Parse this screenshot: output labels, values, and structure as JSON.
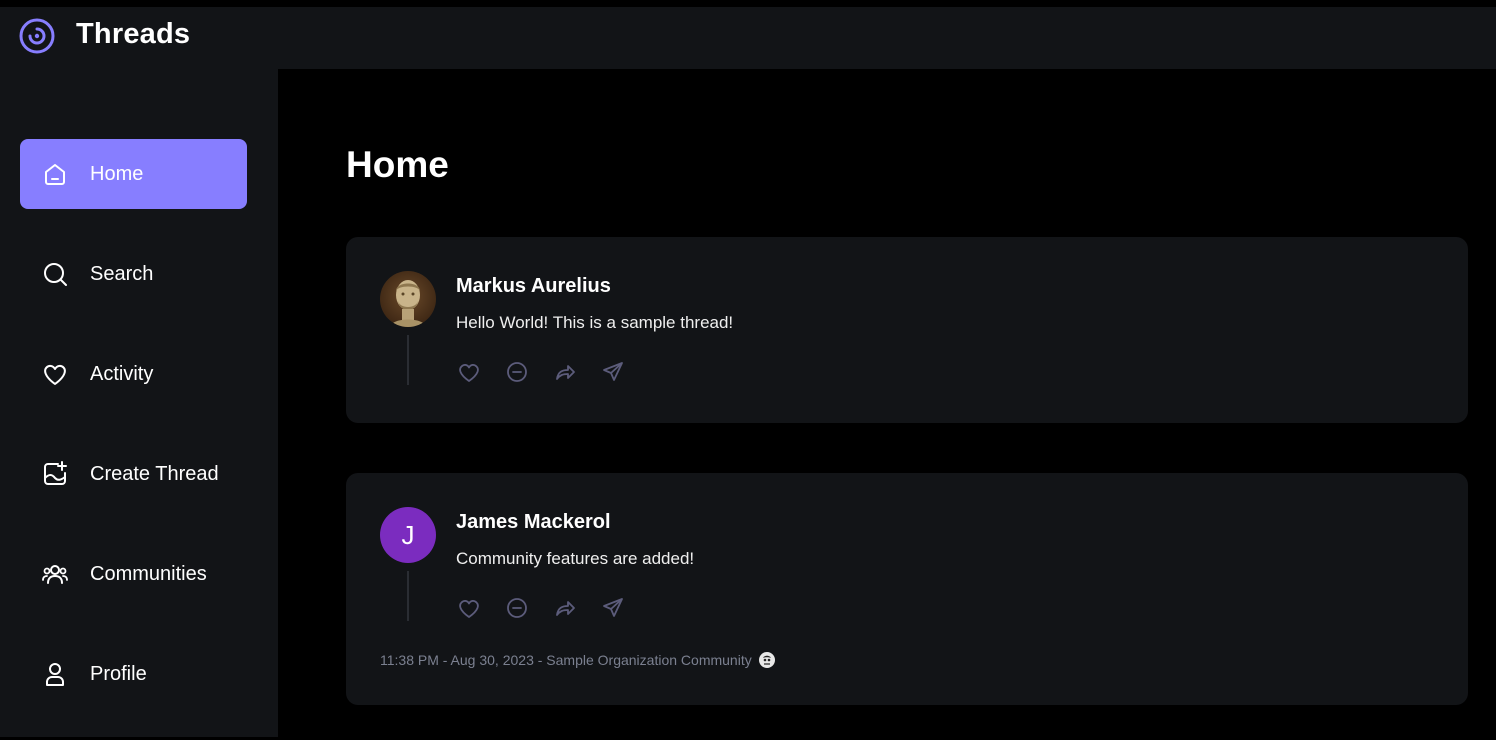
{
  "app": {
    "name": "Threads"
  },
  "sidebar": {
    "items": [
      {
        "label": "Home",
        "icon": "home-icon",
        "active": true
      },
      {
        "label": "Search",
        "icon": "search-icon",
        "active": false
      },
      {
        "label": "Activity",
        "icon": "heart-icon",
        "active": false
      },
      {
        "label": "Create Thread",
        "icon": "create-thread-icon",
        "active": false
      },
      {
        "label": "Communities",
        "icon": "communities-icon",
        "active": false
      },
      {
        "label": "Profile",
        "icon": "user-icon",
        "active": false
      }
    ]
  },
  "main": {
    "title": "Home",
    "threads": [
      {
        "author": "Markus Aurelius",
        "content": "Hello World! This is a sample thread!",
        "avatar": "bust-portrait"
      },
      {
        "author": "James Mackerol",
        "content": "Community features are added!",
        "avatar_letter": "J",
        "meta": "11:38 PM - Aug 30, 2023 - Sample Organization Community"
      }
    ]
  },
  "colors": {
    "accent": "#877eff",
    "panel": "#121417",
    "background": "#000000",
    "avatar_j": "#7b2cbf"
  }
}
